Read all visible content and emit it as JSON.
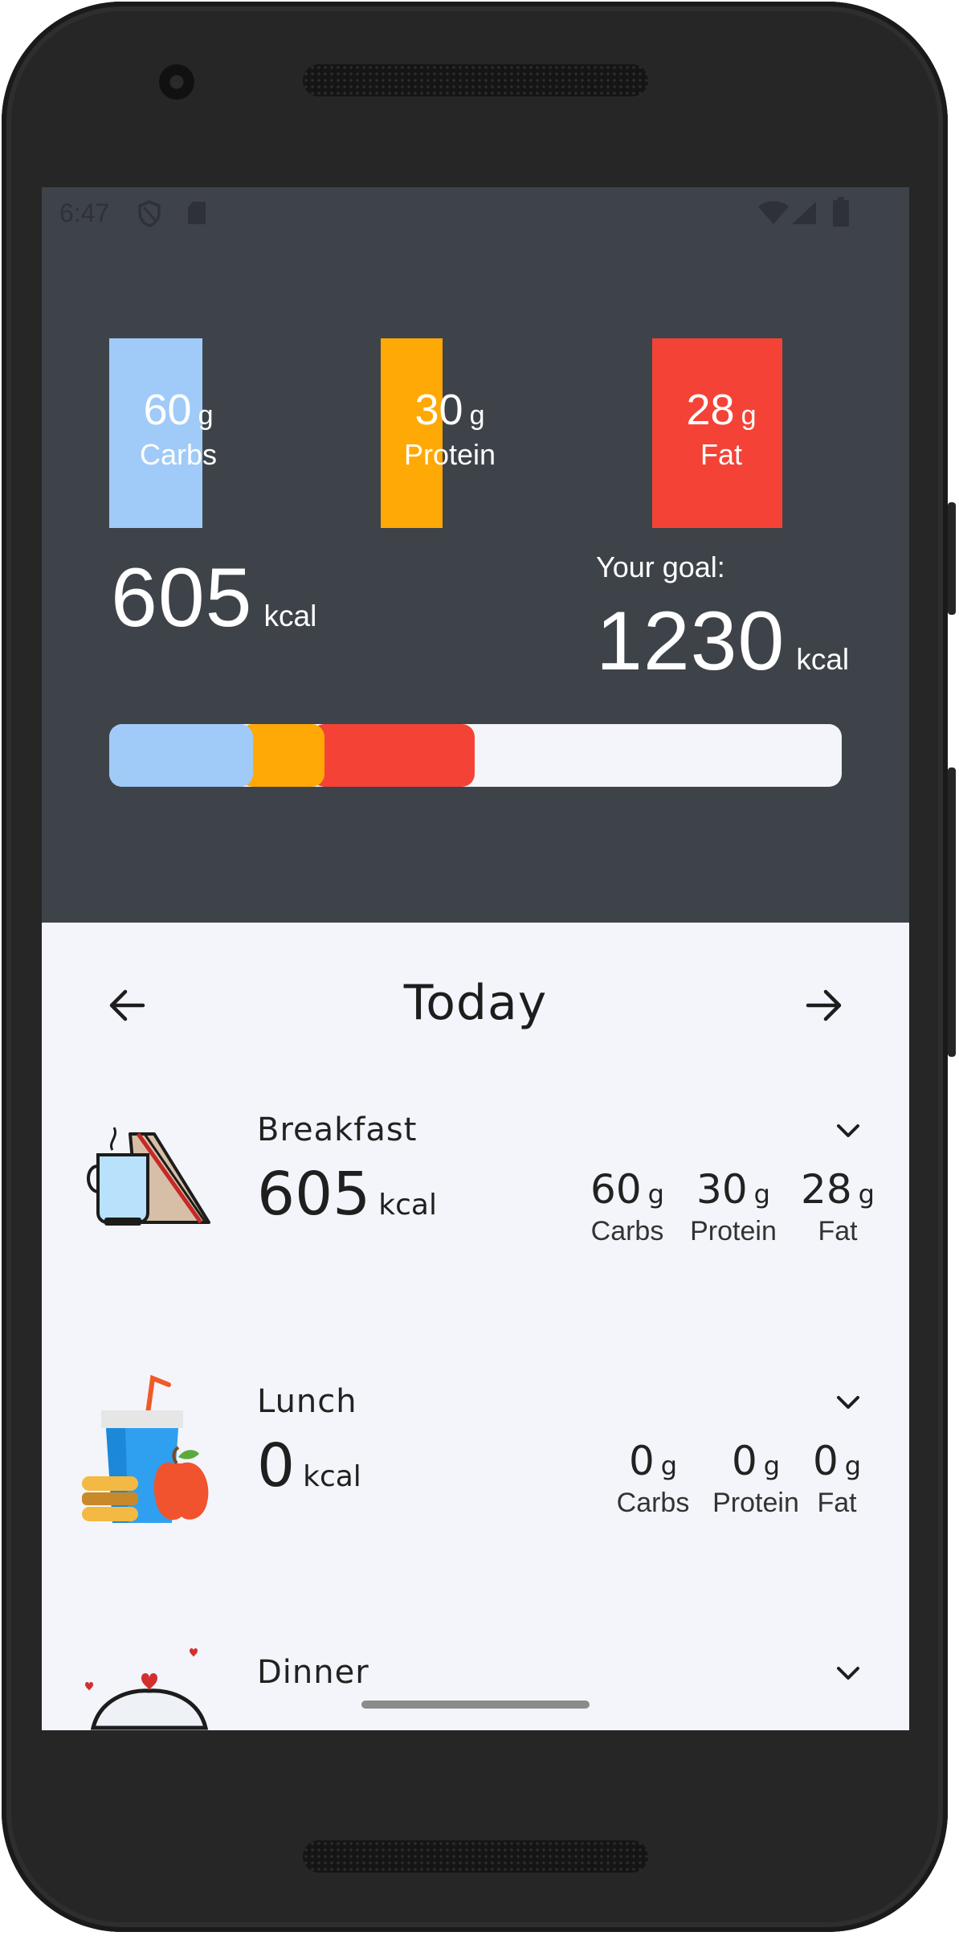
{
  "status_bar": {
    "time": "6:47",
    "icons": [
      "shield-icon",
      "sd-card-icon",
      "wifi-icon",
      "signal-icon",
      "battery-icon"
    ]
  },
  "summary": {
    "macros": [
      {
        "id": "carbs",
        "value": "60",
        "unit": "g",
        "label": "Carbs",
        "color": "#a0cbf8",
        "fill_fraction": 0.68
      },
      {
        "id": "protein",
        "value": "30",
        "unit": "g",
        "label": "Protein",
        "color": "#ffa906",
        "fill_fraction": 0.45
      },
      {
        "id": "fat",
        "value": "28",
        "unit": "g",
        "label": "Fat",
        "color": "#f44336",
        "fill_fraction": 0.95
      }
    ],
    "consumed_kcal": "605",
    "kcal_unit": "kcal",
    "goal_label": "Your goal:",
    "goal_kcal": "1230",
    "progress": {
      "carbs_fraction": 0.196,
      "protein_fraction": 0.098,
      "fat_fraction": 0.205
    }
  },
  "day_nav": {
    "title": "Today",
    "prev_icon": "arrow-left-icon",
    "next_icon": "arrow-right-icon"
  },
  "meals": [
    {
      "name": "Breakfast",
      "kcal": "605",
      "kcal_unit": "kcal",
      "icon": "coffee-sandwich-icon",
      "carbs": "60",
      "protein": "30",
      "fat": "28",
      "unit": "g",
      "carbs_label": "Carbs",
      "protein_label": "Protein",
      "fat_label": "Fat"
    },
    {
      "name": "Lunch",
      "kcal": "0",
      "kcal_unit": "kcal",
      "icon": "drink-burger-apple-icon",
      "carbs": "0",
      "protein": "0",
      "fat": "0",
      "unit": "g",
      "carbs_label": "Carbs",
      "protein_label": "Protein",
      "fat_label": "Fat"
    },
    {
      "name": "Dinner",
      "icon": "cloche-icon"
    }
  ]
}
